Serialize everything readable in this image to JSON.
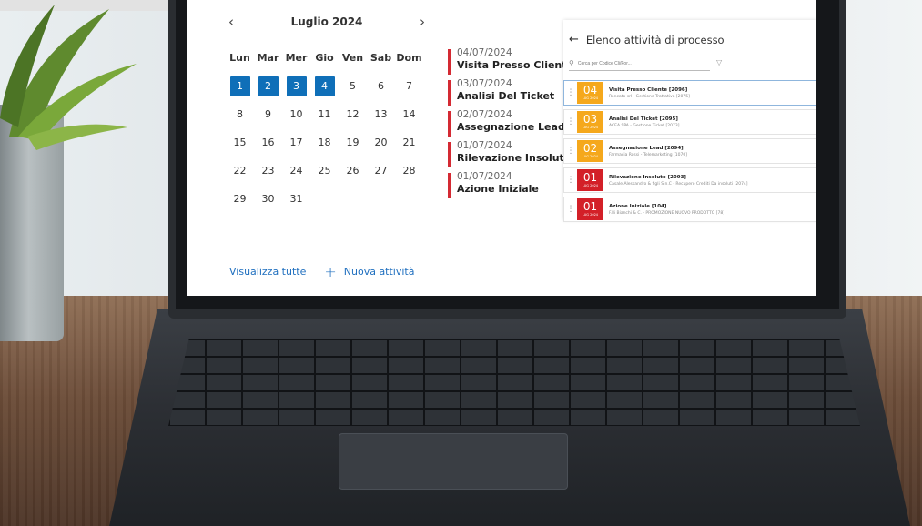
{
  "colors": {
    "accent": "#0f6fb8",
    "timeline_bar": "#d42a33",
    "badge_orange": "#f5a81c",
    "badge_red": "#d32028"
  },
  "calendar": {
    "month_label": "Luglio 2024",
    "prev_icon": "chevron-left-icon",
    "next_icon": "chevron-right-icon",
    "weekdays": [
      "Lun",
      "Mar",
      "Mer",
      "Gio",
      "Ven",
      "Sab",
      "Dom"
    ],
    "weeks": [
      [
        "1",
        "2",
        "3",
        "4",
        "5",
        "6",
        "7"
      ],
      [
        "8",
        "9",
        "10",
        "11",
        "12",
        "13",
        "14"
      ],
      [
        "15",
        "16",
        "17",
        "18",
        "19",
        "20",
        "21"
      ],
      [
        "22",
        "23",
        "24",
        "25",
        "26",
        "27",
        "28"
      ],
      [
        "29",
        "30",
        "31",
        "",
        "",
        "",
        ""
      ]
    ],
    "selected_days": [
      "1",
      "2",
      "3",
      "4"
    ],
    "view_all_label": "Visualizza tutte",
    "new_activity_label": "Nuova attività"
  },
  "timeline": [
    {
      "date": "04/07/2024",
      "title": "Visita Presso Cliente"
    },
    {
      "date": "03/07/2024",
      "title": "Analisi Del Ticket"
    },
    {
      "date": "02/07/2024",
      "title": "Assegnazione Lead"
    },
    {
      "date": "01/07/2024",
      "title": "Rilevazione Insoluto"
    },
    {
      "date": "01/07/2024",
      "title": "Azione Iniziale"
    }
  ],
  "process_panel": {
    "title": "Elenco attività di processo",
    "search_placeholder": "Cerca per Codice Cli/For...",
    "items": [
      {
        "day": "04",
        "month": "LUG 2024",
        "color": "orange",
        "name": "Visita Presso Cliente [2096]",
        "sub": "Roncato srl - Gestione Trattativa [2075]"
      },
      {
        "day": "03",
        "month": "LUG 2024",
        "color": "orange",
        "name": "Analisi Del Ticket [2095]",
        "sub": "ACEA SPA - Gestione Ticket [2073]"
      },
      {
        "day": "02",
        "month": "LUG 2024",
        "color": "orange",
        "name": "Assegnazione Lead [2094]",
        "sub": "Farmacia Rossi - Telemarketing [1070]"
      },
      {
        "day": "01",
        "month": "LUG 2024",
        "color": "red",
        "name": "Rilevazione Insoluto [2093]",
        "sub": "Casale Alessandro & figli S.n.C - Recupero Crediti Da insoluti [2074]"
      },
      {
        "day": "01",
        "month": "LUG 2024",
        "color": "red",
        "name": "Azione Iniziale [104]",
        "sub": "F.lli Bianchi & C. - PROMOZIONE NUOVO PRODOTTO [78]"
      }
    ]
  }
}
